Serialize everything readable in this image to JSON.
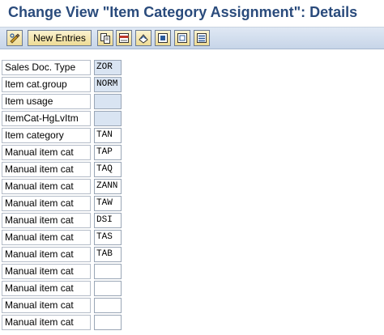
{
  "title": "Change View \"Item Category Assignment\": Details",
  "toolbar": {
    "icons": [
      "display-change-icon",
      "copy-icon",
      "delete-icon",
      "undo-icon",
      "select-all-icon",
      "deselect-all-icon",
      "select-block-icon"
    ],
    "new_entries_label": "New Entries"
  },
  "colors": {
    "title": "#2a4b7c",
    "readonly_field": "#d9e4f2",
    "toolbar_button": "#eedb95"
  },
  "form": {
    "rows": [
      {
        "label": "Sales Doc. Type",
        "value": "ZOR",
        "readonly": true
      },
      {
        "label": "Item cat.group",
        "value": "NORM",
        "readonly": true
      },
      {
        "label": "Item usage",
        "value": "",
        "readonly": true
      },
      {
        "label": "ItemCat-HgLvItm",
        "value": "",
        "readonly": true
      },
      {
        "label": "Item category",
        "value": "TAN",
        "readonly": false
      },
      {
        "label": "Manual item cat",
        "value": "TAP",
        "readonly": false
      },
      {
        "label": "Manual item cat",
        "value": "TAQ",
        "readonly": false
      },
      {
        "label": "Manual item cat",
        "value": "ZANN",
        "readonly": false
      },
      {
        "label": "Manual item cat",
        "value": "TAW",
        "readonly": false
      },
      {
        "label": "Manual item cat",
        "value": "DSI",
        "readonly": false
      },
      {
        "label": "Manual item cat",
        "value": "TAS",
        "readonly": false
      },
      {
        "label": "Manual item cat",
        "value": "TAB",
        "readonly": false
      },
      {
        "label": "Manual item cat",
        "value": "",
        "readonly": false
      },
      {
        "label": "Manual item cat",
        "value": "",
        "readonly": false
      },
      {
        "label": "Manual item cat",
        "value": "",
        "readonly": false
      },
      {
        "label": "Manual item cat",
        "value": "",
        "readonly": false
      }
    ]
  }
}
